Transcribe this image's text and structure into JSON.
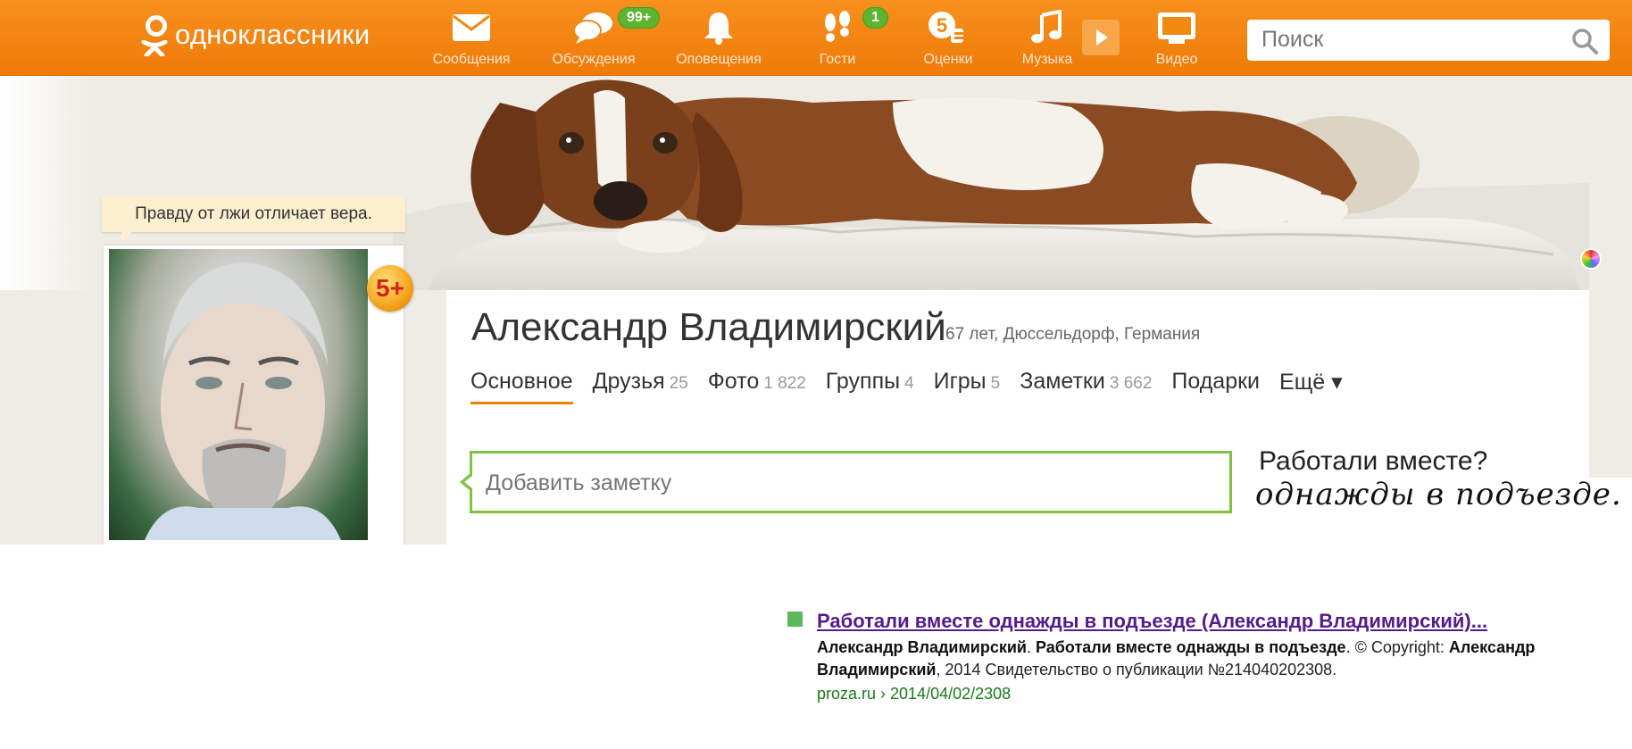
{
  "header": {
    "logo_text": "одноклассники",
    "nav": [
      {
        "label": "Сообщения",
        "icon": "envelope-icon",
        "badge": ""
      },
      {
        "label": "Обсуждения",
        "icon": "chat-bubbles-icon",
        "badge": "99+"
      },
      {
        "label": "Оповещения",
        "icon": "bell-icon",
        "badge": ""
      },
      {
        "label": "Гости",
        "icon": "footprints-icon",
        "badge": "1"
      },
      {
        "label": "Оценки",
        "icon": "grade-five-icon",
        "badge": ""
      },
      {
        "label": "Музыка",
        "icon": "music-note-icon",
        "badge": ""
      },
      {
        "label": "Видео",
        "icon": "video-icon",
        "badge": ""
      }
    ],
    "search_placeholder": "Поиск"
  },
  "profile": {
    "status_quote": "Правду от лжи отличает вера.",
    "badge_5plus": "5+",
    "name": "Александр Владимирский",
    "meta": "67 лет, Дюссельдорф, Германия",
    "tabs": [
      {
        "label": "Основное",
        "count": ""
      },
      {
        "label": "Друзья",
        "count": "25"
      },
      {
        "label": "Фото",
        "count": "1 822"
      },
      {
        "label": "Группы",
        "count": "4"
      },
      {
        "label": "Игры",
        "count": "5"
      },
      {
        "label": "Заметки",
        "count": "3 662"
      },
      {
        "label": "Подарки",
        "count": ""
      },
      {
        "label": "Ещё ▾",
        "count": ""
      }
    ],
    "note_placeholder": "Добавить заметку",
    "overlay_line1": "Работали вместе?",
    "overlay_line2": "однажды в подъезде."
  },
  "search_result": {
    "title": "Работали вместе однажды в подъезде (Александр Владимирский)...",
    "snippet_parts": {
      "b1": "Александр Владимирский",
      "t1": ". ",
      "b2": "Работали вместе однажды в подъезде",
      "t2": ". © Copyright: ",
      "b3": "Александр Владимирский",
      "t3": ", 2014 Свидетельство о публикации №214040202308."
    },
    "url": "proza.ru › 2014/04/02/2308"
  },
  "colors": {
    "brand_orange": "#ee8208",
    "badge_green": "#5cb52e",
    "note_border": "#7dc242",
    "link_purple": "#551a8b",
    "url_green": "#1a7a1a"
  }
}
